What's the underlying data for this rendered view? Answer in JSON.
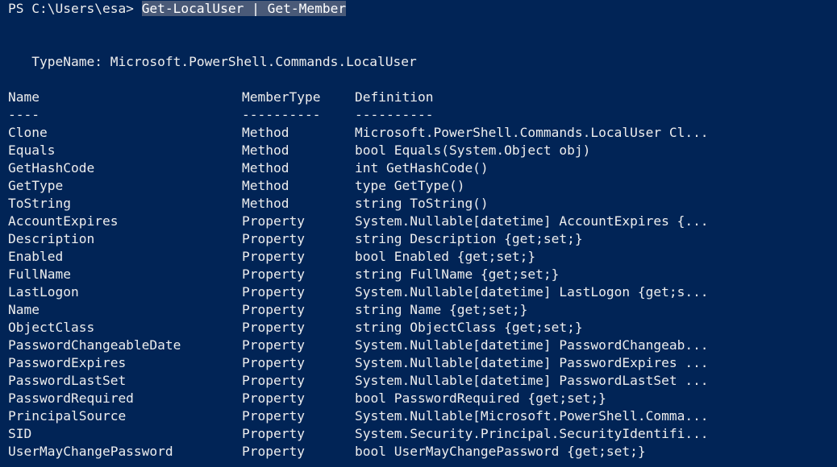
{
  "terminal": {
    "background_color": "#012456",
    "foreground_color": "#eeeeee",
    "selection_color": "#4a5a78",
    "prompt": {
      "prefix": "PS C:\\Users\\esa> ",
      "command": "Get-LocalUser | Get-Member",
      "command_selected": true
    },
    "typename_line": "   TypeName: Microsoft.PowerShell.Commands.LocalUser",
    "table": {
      "headers": {
        "name": "Name",
        "member_type": "MemberType",
        "definition": "Definition"
      },
      "rules": {
        "name": "----",
        "member_type": "----------",
        "definition": "----------"
      },
      "rows": [
        {
          "name": "Clone",
          "member_type": "Method",
          "definition": "Microsoft.PowerShell.Commands.LocalUser Cl..."
        },
        {
          "name": "Equals",
          "member_type": "Method",
          "definition": "bool Equals(System.Object obj)"
        },
        {
          "name": "GetHashCode",
          "member_type": "Method",
          "definition": "int GetHashCode()"
        },
        {
          "name": "GetType",
          "member_type": "Method",
          "definition": "type GetType()"
        },
        {
          "name": "ToString",
          "member_type": "Method",
          "definition": "string ToString()"
        },
        {
          "name": "AccountExpires",
          "member_type": "Property",
          "definition": "System.Nullable[datetime] AccountExpires {..."
        },
        {
          "name": "Description",
          "member_type": "Property",
          "definition": "string Description {get;set;}"
        },
        {
          "name": "Enabled",
          "member_type": "Property",
          "definition": "bool Enabled {get;set;}"
        },
        {
          "name": "FullName",
          "member_type": "Property",
          "definition": "string FullName {get;set;}"
        },
        {
          "name": "LastLogon",
          "member_type": "Property",
          "definition": "System.Nullable[datetime] LastLogon {get;s..."
        },
        {
          "name": "Name",
          "member_type": "Property",
          "definition": "string Name {get;set;}"
        },
        {
          "name": "ObjectClass",
          "member_type": "Property",
          "definition": "string ObjectClass {get;set;}"
        },
        {
          "name": "PasswordChangeableDate",
          "member_type": "Property",
          "definition": "System.Nullable[datetime] PasswordChangeab..."
        },
        {
          "name": "PasswordExpires",
          "member_type": "Property",
          "definition": "System.Nullable[datetime] PasswordExpires ..."
        },
        {
          "name": "PasswordLastSet",
          "member_type": "Property",
          "definition": "System.Nullable[datetime] PasswordLastSet ..."
        },
        {
          "name": "PasswordRequired",
          "member_type": "Property",
          "definition": "bool PasswordRequired {get;set;}"
        },
        {
          "name": "PrincipalSource",
          "member_type": "Property",
          "definition": "System.Nullable[Microsoft.PowerShell.Comma..."
        },
        {
          "name": "SID",
          "member_type": "Property",
          "definition": "System.Security.Principal.SecurityIdentifi..."
        },
        {
          "name": "UserMayChangePassword",
          "member_type": "Property",
          "definition": "bool UserMayChangePassword {get;set;}"
        }
      ]
    }
  }
}
